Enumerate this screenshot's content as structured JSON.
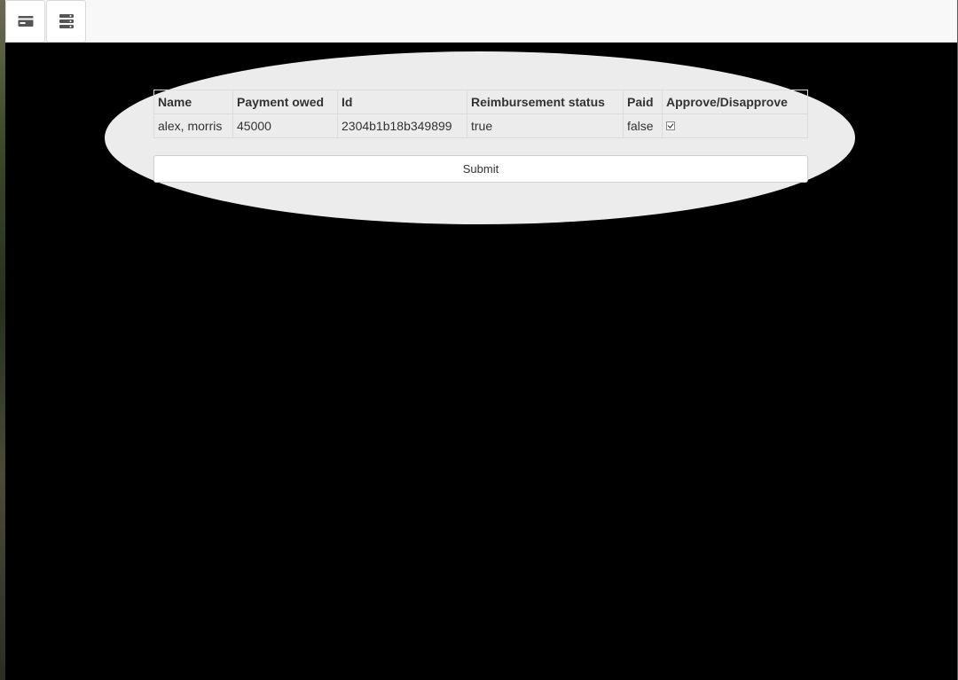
{
  "toolbar": {
    "buttons": [
      {
        "icon": "card-icon"
      },
      {
        "icon": "list-layout-icon"
      }
    ]
  },
  "table": {
    "headers": [
      "Name",
      "Payment owed",
      "Id",
      "Reimbursement status",
      "Paid",
      "Approve/Disapprove"
    ],
    "rows": [
      {
        "name": "alex, morris",
        "payment_owed": "45000",
        "id": "2304b1b18b349899",
        "reimbursement_status": "true",
        "paid": "false",
        "approve_checked": true
      }
    ]
  },
  "form": {
    "submit_label": "Submit"
  }
}
